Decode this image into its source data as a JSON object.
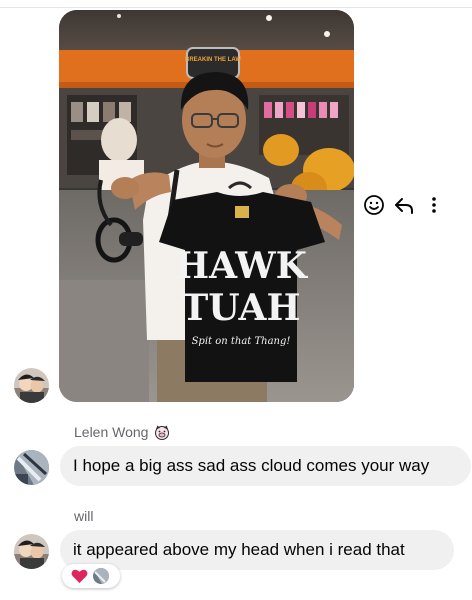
{
  "messages": [
    {
      "type": "photo",
      "shirt_text_line1": "HAWK",
      "shirt_text_line2": "TUAH",
      "shirt_script": "Spit on that Thang!",
      "store_sign": "BREAKIN THE LAW",
      "tag_text": "tag"
    },
    {
      "type": "text",
      "sender": "Lelen Wong",
      "sender_emoji": "pig-face-emoji",
      "text": "I hope a big ass sad ass cloud comes your way"
    },
    {
      "type": "text",
      "sender": "will",
      "text": "it appeared above my head when i read that",
      "reactions": [
        "heart-emoji"
      ]
    }
  ],
  "hover_actions": [
    "react-icon",
    "reply-icon",
    "more-icon"
  ],
  "colors": {
    "bubble": "#f0f0f0",
    "sender_name": "#65676b",
    "text": "#050505",
    "heart": "#e0245e"
  }
}
